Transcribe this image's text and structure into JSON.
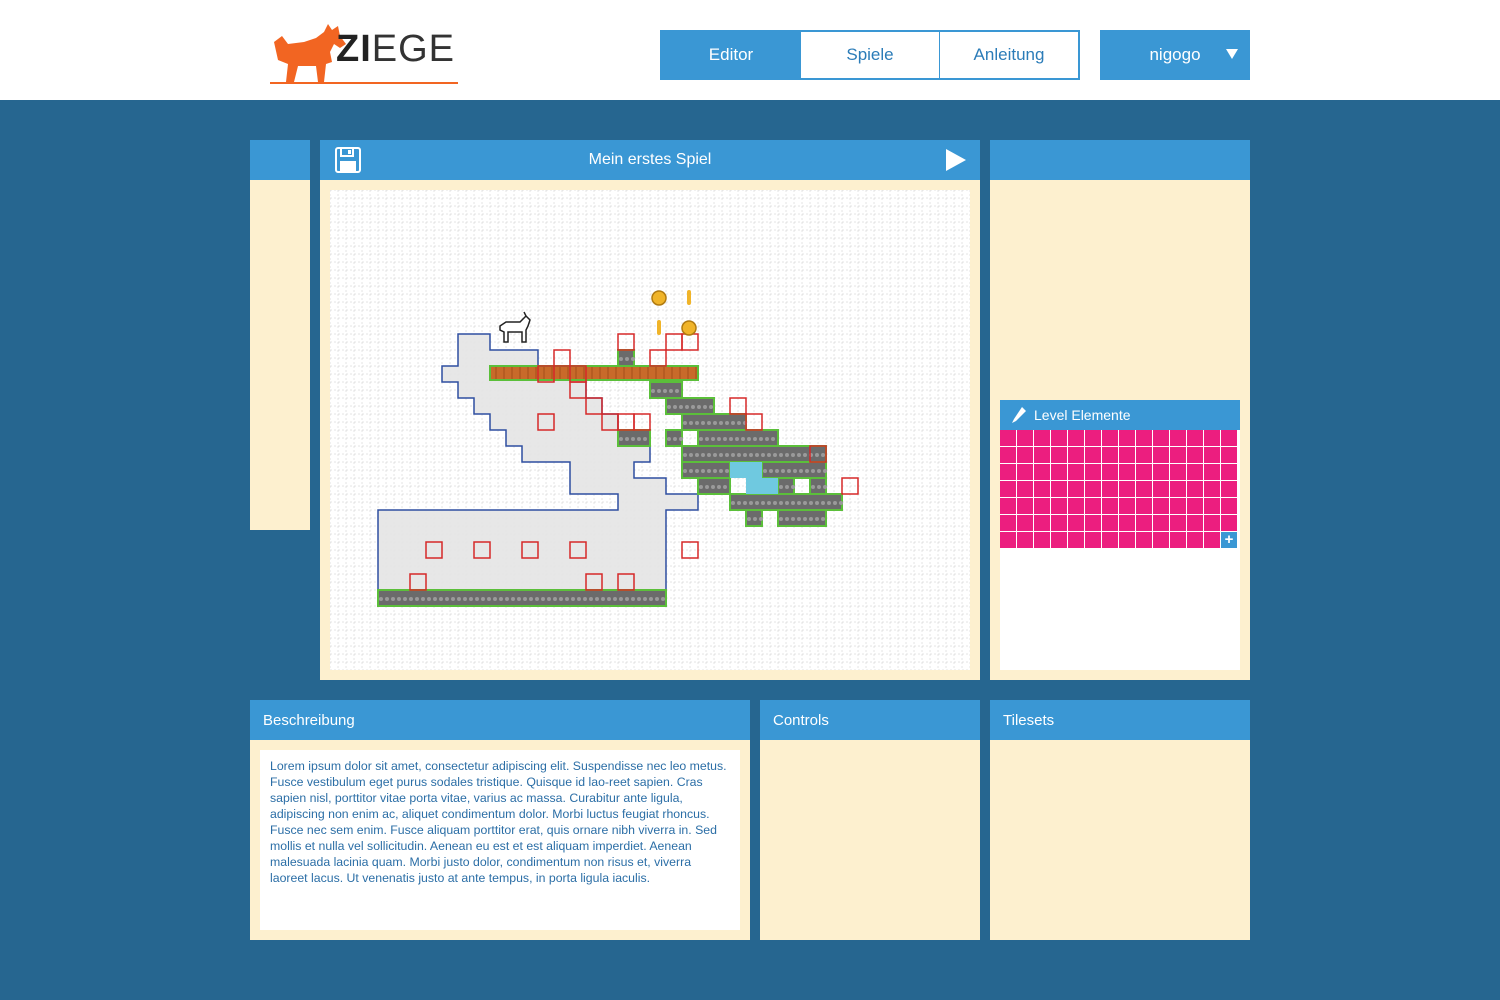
{
  "brand": {
    "name_part1": "ZI",
    "name_part2": "EGE",
    "accent": "#f26522"
  },
  "nav": {
    "tabs": [
      {
        "label": "Editor",
        "active": true
      },
      {
        "label": "Spiele",
        "active": false
      },
      {
        "label": "Anleitung",
        "active": false
      }
    ]
  },
  "user": {
    "name": "nigogo",
    "icon": "chevron-down-icon"
  },
  "editor": {
    "title": "Mein erstes Spiel",
    "save_icon": "save-icon",
    "play_icon": "play-icon"
  },
  "level_elements": {
    "title": "Level Elemente",
    "icon": "pencil-icon",
    "tile_count": 97,
    "tile_color": "#ec1e7f",
    "add_label": "+"
  },
  "description": {
    "title": "Beschreibung",
    "text": "Lorem ipsum dolor sit amet, consectetur adipiscing elit. Suspendisse nec leo metus. Fusce vestibulum eget purus sodales tristique. Quisque id lao-reet sapien. Cras sapien nisl, porttitor vitae porta vitae, varius ac massa. Curabitur ante ligula, adipiscing non enim ac, aliquet condimentum dolor. Morbi luctus feugiat rhoncus. Fusce nec sem enim. Fusce aliquam porttitor erat, quis ornare nibh viverra in. Sed mollis et nulla vel sollicitudin. Aenean eu est et est aliquam imperdiet. Aenean malesuada lacinia quam. Morbi justo dolor, condimentum non risus et, viverra laoreet lacus. Ut venenatis justo at ante tempus, in porta ligula iaculis."
  },
  "controls": {
    "title": "Controls"
  },
  "tilesets": {
    "title": "Tilesets"
  },
  "colors": {
    "background": "#266690",
    "primary": "#3a97d4",
    "panel": "#fdf0cf",
    "grass": "#5bbf3a",
    "brick": "#c86a2a",
    "stone": "#6b6b6b",
    "water": "#6fc9e0",
    "coin": "#f0b429",
    "trigger_outline": "#d62828",
    "zone_outline": "#2f4fa0"
  }
}
